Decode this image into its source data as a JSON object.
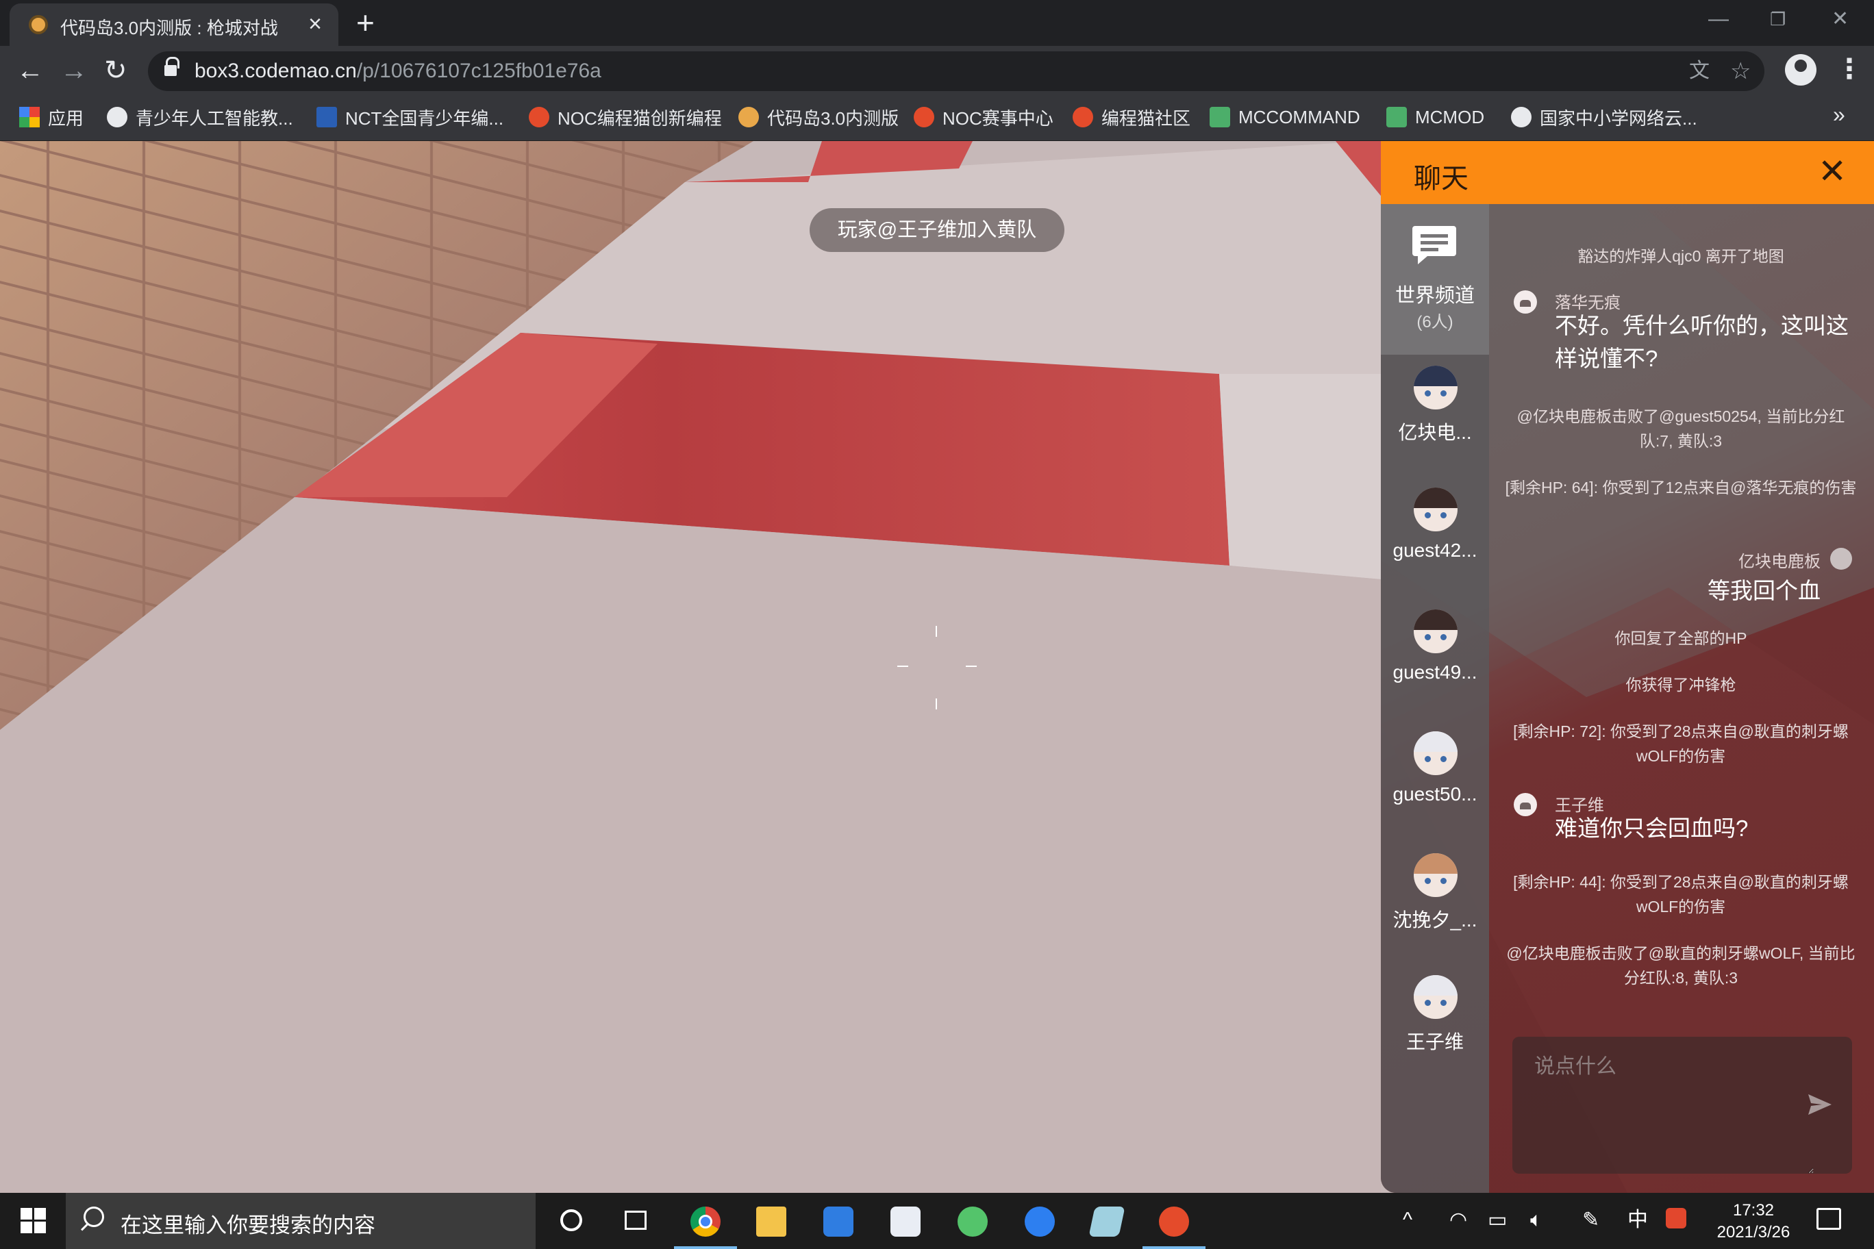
{
  "browser": {
    "tab_title": "代码岛3.0内测版 : 枪城对战",
    "url_host": "box3.codemao.cn",
    "url_path": "/p/10676107c125fb01e76a",
    "bookmarks": [
      {
        "label": "应用",
        "icon": "apps-grid-icon",
        "color": "#ea4335"
      },
      {
        "label": "青少年人工智能教...",
        "icon": "globe-icon",
        "color": "#e8eaed"
      },
      {
        "label": "NCT全国青少年编...",
        "icon": "nct-logo-icon",
        "color": "#2a5fb4"
      },
      {
        "label": "NOC编程猫创新编程",
        "icon": "codemao-cat-icon",
        "color": "#e44b2b"
      },
      {
        "label": "代码岛3.0内测版",
        "icon": "codemao-island-icon",
        "color": "#e9a84a"
      },
      {
        "label": "NOC赛事中心",
        "icon": "codemao-cat-icon",
        "color": "#e44b2b"
      },
      {
        "label": "编程猫社区",
        "icon": "codemao-cat-icon",
        "color": "#e44b2b"
      },
      {
        "label": "MCCOMMAND",
        "icon": "mc-icon",
        "color": "#4cae6a"
      },
      {
        "label": "MCMOD",
        "icon": "mc-icon",
        "color": "#4cae6a"
      },
      {
        "label": "国家中小学网络云...",
        "icon": "globe-icon",
        "color": "#e8eaed"
      }
    ]
  },
  "game": {
    "toast": "玩家@王子维加入黄队"
  },
  "chat": {
    "title": "聊天",
    "accent_color": "#fb8a12",
    "channel": {
      "name": "世界频道",
      "count": "(6人)"
    },
    "members": [
      {
        "name": "亿块电...",
        "hair": "#2c3550"
      },
      {
        "name": "guest42...",
        "hair": "#3a2a28"
      },
      {
        "name": "guest49...",
        "hair": "#3a2a28"
      },
      {
        "name": "guest50...",
        "hair": "#e8e8ee"
      },
      {
        "name": "沈挽夕_...",
        "hair": "#c9906a"
      },
      {
        "name": "王子维",
        "hair": "#e8e8ee"
      }
    ],
    "messages": {
      "m1": "豁达的炸弹人qjc0 离开了地图",
      "m2_user": "落华无痕",
      "m2_text": "不好。凭什么听你的，这叫这样说懂不?",
      "m3": "@亿块电鹿板击败了@guest50254, 当前比分红队:7, 黄队:3",
      "m4": "[剩余HP: 64]: 你受到了12点来自@落华无痕的伤害",
      "m5_user": "亿块电鹿板",
      "m5_text": "等我回个血",
      "m6": "你回复了全部的HP",
      "m7": "你获得了冲锋枪",
      "m8": "[剩余HP: 72]: 你受到了28点来自@耿直的刺牙螺wOLF的伤害",
      "m9_user": "王子维",
      "m9_text": "难道你只会回血吗?",
      "m10": "[剩余HP: 44]: 你受到了28点来自@耿直的刺牙螺wOLF的伤害",
      "m11": "@亿块电鹿板击败了@耿直的刺牙螺wOLF, 当前比分红队:8, 黄队:3"
    },
    "input_placeholder": "说点什么"
  },
  "taskbar": {
    "search_placeholder": "在这里输入你要搜索的内容",
    "ime": "中",
    "time": "17:32",
    "date": "2021/3/26",
    "apps": [
      "chrome-icon",
      "file-explorer-icon",
      "photos-icon",
      "notepad-icon",
      "scratch-icon",
      "sogou-icon",
      "tablet-icon",
      "maker-icon"
    ]
  }
}
